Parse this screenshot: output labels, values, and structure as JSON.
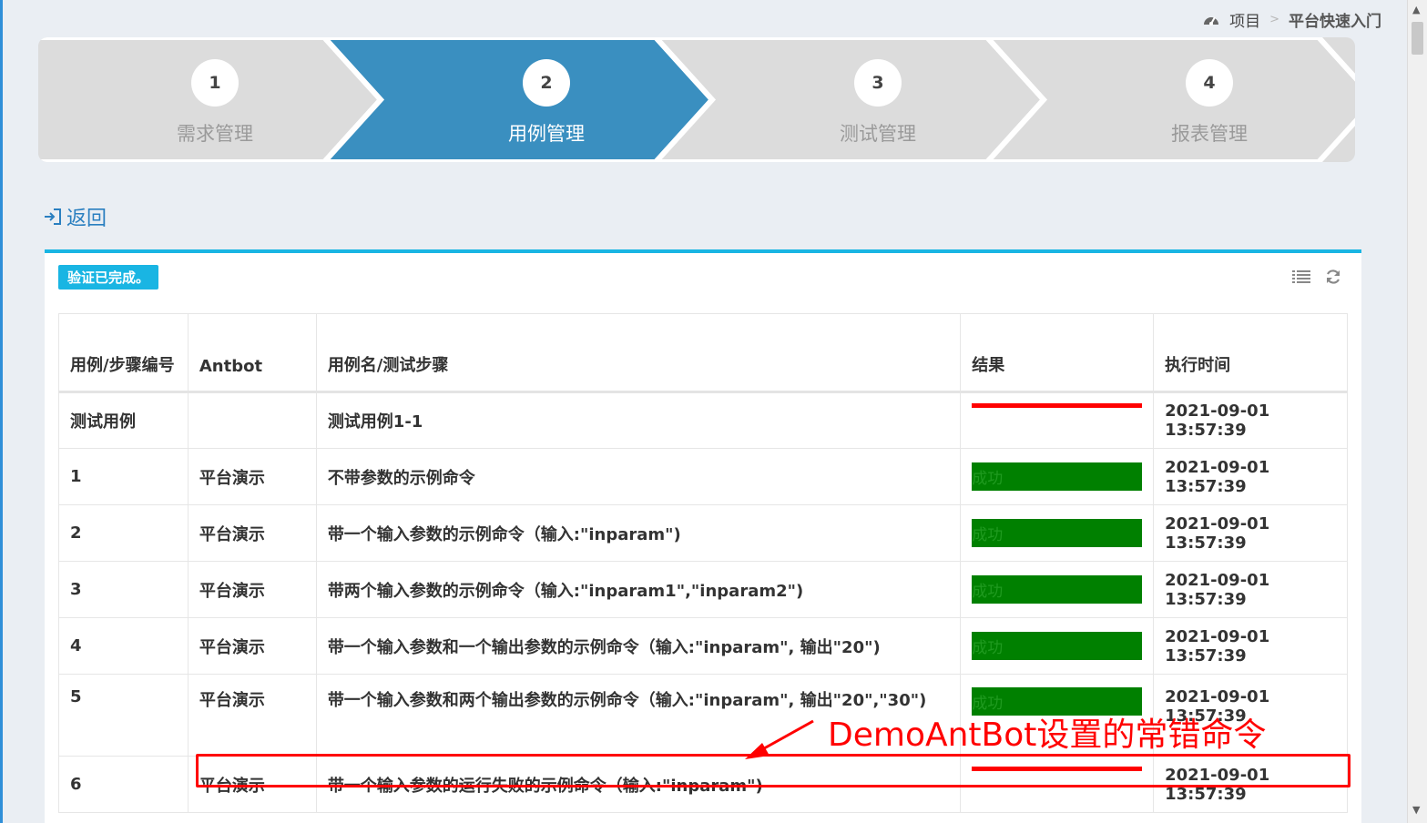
{
  "breadcrumb": {
    "root": "项目",
    "separator": ">",
    "current": "平台快速入门"
  },
  "wizard": {
    "steps": [
      {
        "num": "1",
        "label": "需求管理"
      },
      {
        "num": "2",
        "label": "用例管理"
      },
      {
        "num": "3",
        "label": "测试管理"
      },
      {
        "num": "4",
        "label": "报表管理"
      }
    ],
    "active_index": 1,
    "active_color": "#3a8fc0",
    "inactive_color": "#dcdcdc"
  },
  "back": {
    "label": "返回",
    "icon": "sign-in-icon"
  },
  "panel": {
    "badge": "验证已完成。",
    "tools": [
      "list-icon",
      "refresh-icon"
    ],
    "accent_color": "#19b5e3"
  },
  "table": {
    "headers": [
      "用例/步骤编号",
      "Antbot",
      "用例名/测试步骤",
      "结果",
      "执行时间"
    ],
    "rows": [
      {
        "id": "测试用例",
        "antbot": "",
        "name": "测试用例1-1",
        "result": "",
        "status": "failed",
        "time": "2021-09-01 13:57:39"
      },
      {
        "id": "1",
        "antbot": "平台演示",
        "name": "不带参数的示例命令",
        "result": "成功",
        "status": "success",
        "time": "2021-09-01 13:57:39"
      },
      {
        "id": "2",
        "antbot": "平台演示",
        "name": "带一个输入参数的示例命令（输入:\"inparam\")",
        "result": "成功",
        "status": "success",
        "time": "2021-09-01 13:57:39"
      },
      {
        "id": "3",
        "antbot": "平台演示",
        "name": "带两个输入参数的示例命令（输入:\"inparam1\",\"inparam2\")",
        "result": "成功",
        "status": "success",
        "time": "2021-09-01 13:57:39"
      },
      {
        "id": "4",
        "antbot": "平台演示",
        "name": "带一个输入参数和一个输出参数的示例命令（输入:\"inparam\", 输出\"20\")",
        "result": "成功",
        "status": "success",
        "time": "2021-09-01 13:57:39"
      },
      {
        "id": "5",
        "antbot": "平台演示",
        "name": "带一个输入参数和两个输出参数的示例命令（输入:\"inparam\", 输出\"20\",\"30\")",
        "result": "成功",
        "status": "success",
        "time": "2021-09-01 13:57:39"
      },
      {
        "id": "6",
        "antbot": "平台演示",
        "name": "带一个输入参数的运行失败的示例命令（输入:\"inparam\")",
        "result": "",
        "status": "failed",
        "time": "2021-09-01 13:57:39"
      }
    ],
    "success_color": "#008000",
    "fail_color": "#ff0000"
  },
  "annotation": {
    "caption": "DemoAntBot设置的常错命令",
    "color": "#ff0000"
  }
}
